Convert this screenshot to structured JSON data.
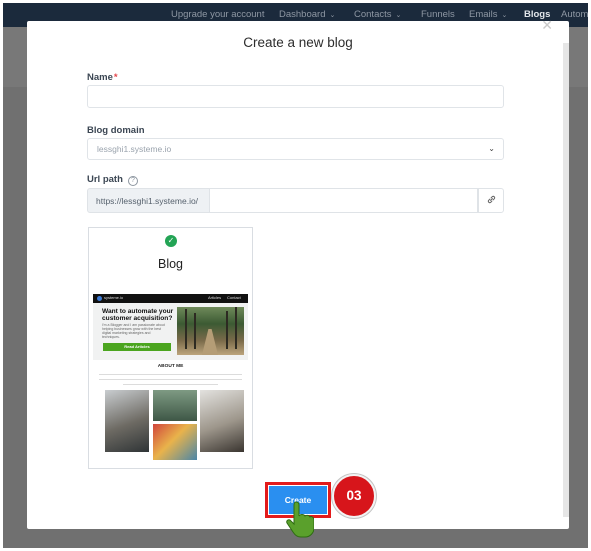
{
  "topnav": {
    "items": [
      {
        "label": "Upgrade your account",
        "dropdown": false
      },
      {
        "label": "Dashboard",
        "dropdown": true
      },
      {
        "label": "Contacts",
        "dropdown": true
      },
      {
        "label": "Funnels",
        "dropdown": false
      },
      {
        "label": "Emails",
        "dropdown": true
      },
      {
        "label": "Blogs",
        "dropdown": false,
        "active": true
      },
      {
        "label": "Autom",
        "dropdown": false
      }
    ]
  },
  "modal": {
    "title": "Create a new blog",
    "close_icon": "close-icon",
    "name_field": {
      "label": "Name",
      "required_mark": "*",
      "value": ""
    },
    "blog_domain": {
      "label": "Blog domain",
      "value": "lessghi1.systeme.io"
    },
    "url_path": {
      "label": "Url path",
      "help_icon": "?",
      "prefix": "https://lessghi1.systeme.io/",
      "value": ""
    },
    "template": {
      "title": "Blog",
      "selected": true,
      "preview": {
        "logo_text": "systeme.io",
        "nav_links": [
          "Articles",
          "Contact"
        ],
        "hero_heading": "Want to automate your customer acquisition?",
        "hero_text": "I'm a Blogger and I am passionate about helping businesses grow with the best digital marketing strategies and techniques.",
        "hero_button": "Read Articles",
        "about_heading": "ABOUT ME"
      }
    },
    "create_button": "Create"
  },
  "annotation": {
    "step_number": "03"
  },
  "colors": {
    "primary": "#2a8ff0",
    "highlight": "#e31b1b",
    "success": "#23a455",
    "nav_bg": "#1b2a3c"
  }
}
